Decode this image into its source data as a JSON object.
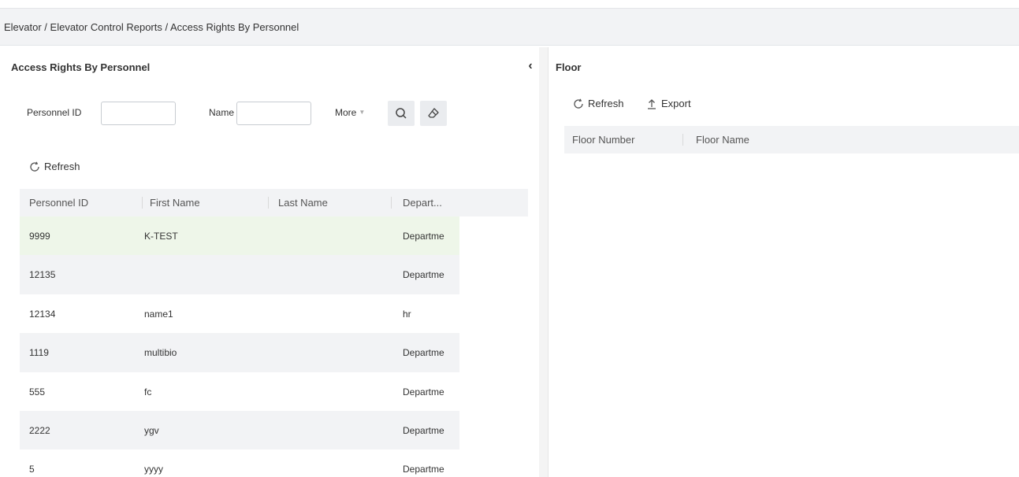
{
  "breadcrumb": "Elevator / Elevator Control Reports / Access Rights By Personnel",
  "left_panel": {
    "title": "Access Rights By Personnel",
    "collapse_icon": "chevron-left-icon",
    "filters": {
      "personnel_id_label": "Personnel ID",
      "personnel_id_value": "",
      "name_label": "Name",
      "name_value": "",
      "more_label": "More"
    },
    "refresh_label": "Refresh",
    "table": {
      "columns": [
        "Personnel ID",
        "First Name",
        "Last Name",
        "Depart..."
      ],
      "rows": [
        {
          "id": "9999",
          "first": "K-TEST",
          "last": "",
          "dept": "Departme"
        },
        {
          "id": "12135",
          "first": "",
          "last": "",
          "dept": "Departme"
        },
        {
          "id": "12134",
          "first": "name1",
          "last": "",
          "dept": "hr"
        },
        {
          "id": "1119",
          "first": "multibio",
          "last": "",
          "dept": "Departme"
        },
        {
          "id": "555",
          "first": "fc",
          "last": "",
          "dept": "Departme"
        },
        {
          "id": "2222",
          "first": "ygv",
          "last": "",
          "dept": "Departme"
        },
        {
          "id": "5",
          "first": "yyyy",
          "last": "",
          "dept": "Departme"
        }
      ]
    }
  },
  "right_panel": {
    "title": "Floor",
    "refresh_label": "Refresh",
    "export_label": "Export",
    "columns": [
      "Floor Number",
      "Floor Name"
    ]
  },
  "colors": {
    "header_bg": "#f2f3f5",
    "selected_row_bg": "#eef6e9",
    "border": "#c8ccd1"
  }
}
